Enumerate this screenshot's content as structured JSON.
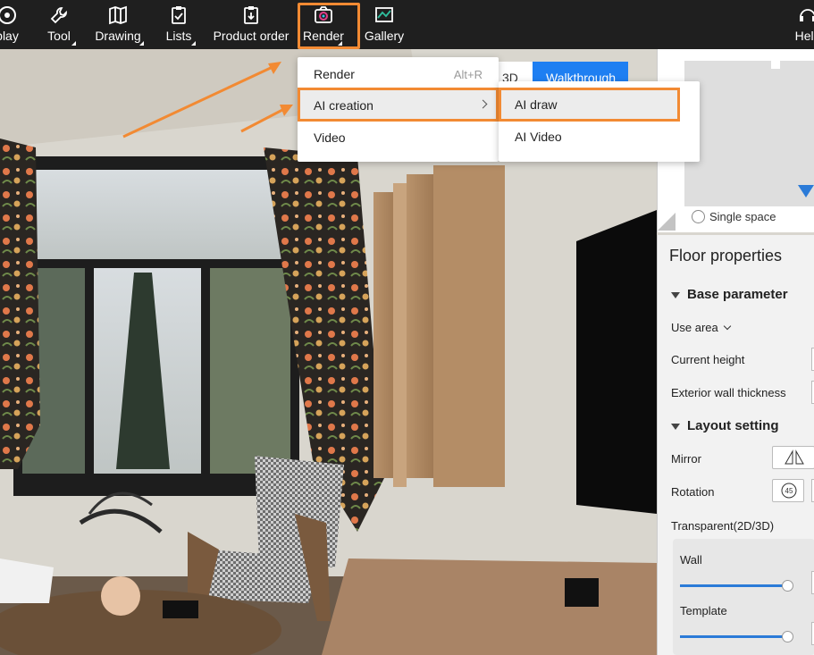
{
  "toolbar": {
    "items": [
      {
        "label": "play",
        "icon": "eye-icon"
      },
      {
        "label": "Tool",
        "icon": "wrench-icon"
      },
      {
        "label": "Drawing",
        "icon": "map-icon"
      },
      {
        "label": "Lists",
        "icon": "clipboard-check-icon"
      },
      {
        "label": "Product order",
        "icon": "clipboard-download-icon"
      },
      {
        "label": "Render",
        "icon": "camera-icon"
      },
      {
        "label": "Gallery",
        "icon": "chart-picture-icon"
      },
      {
        "label": "Help",
        "icon": "headset-icon"
      }
    ]
  },
  "view_tabs": {
    "tab_3d": "3D",
    "walkthrough": "Walkthrough"
  },
  "render_menu": {
    "items": [
      {
        "label": "Render",
        "shortcut": "Alt+R"
      },
      {
        "label": "AI creation",
        "has_submenu": true
      },
      {
        "label": "Video"
      }
    ],
    "submenu": [
      {
        "label": "AI draw"
      },
      {
        "label": "AI Video"
      }
    ]
  },
  "minimap": {
    "single_space": "Single space"
  },
  "properties": {
    "title": "Floor properties",
    "base_parameter": "Base parameter",
    "use_area": "Use area",
    "current_height": "Current height",
    "exterior_wall_thickness": "Exterior wall thickness",
    "layout_setting": "Layout setting",
    "mirror": "Mirror",
    "rotation": "Rotation",
    "rotation_icon_label": "45",
    "transparent": "Transparent(2D/3D)",
    "wall": "Wall",
    "template": "Template",
    "wall_level": 1.0,
    "template_level": 1.0
  },
  "colors": {
    "accent": "#1e7ff2",
    "highlight": "#f28a33",
    "toolbar_bg": "#1f1f1f"
  }
}
